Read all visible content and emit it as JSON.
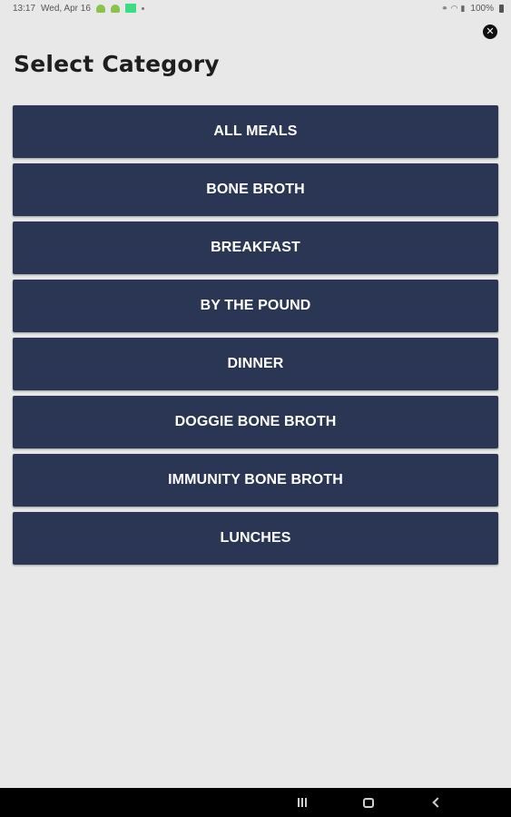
{
  "status_bar": {
    "time": "13:17",
    "date": "Wed, Apr 16",
    "battery": "100%"
  },
  "page": {
    "title": "Select Category",
    "close_icon": "✕"
  },
  "categories": [
    {
      "label": "ALL MEALS"
    },
    {
      "label": "BONE BROTH"
    },
    {
      "label": "BREAKFAST"
    },
    {
      "label": "BY THE POUND"
    },
    {
      "label": "DINNER"
    },
    {
      "label": "DOGGIE BONE BROTH"
    },
    {
      "label": "IMMUNITY BONE BROTH"
    },
    {
      "label": "LUNCHES"
    }
  ],
  "colors": {
    "button_bg": "#2b3654",
    "button_text": "#ffffff",
    "page_bg": "#e8e8e8"
  }
}
